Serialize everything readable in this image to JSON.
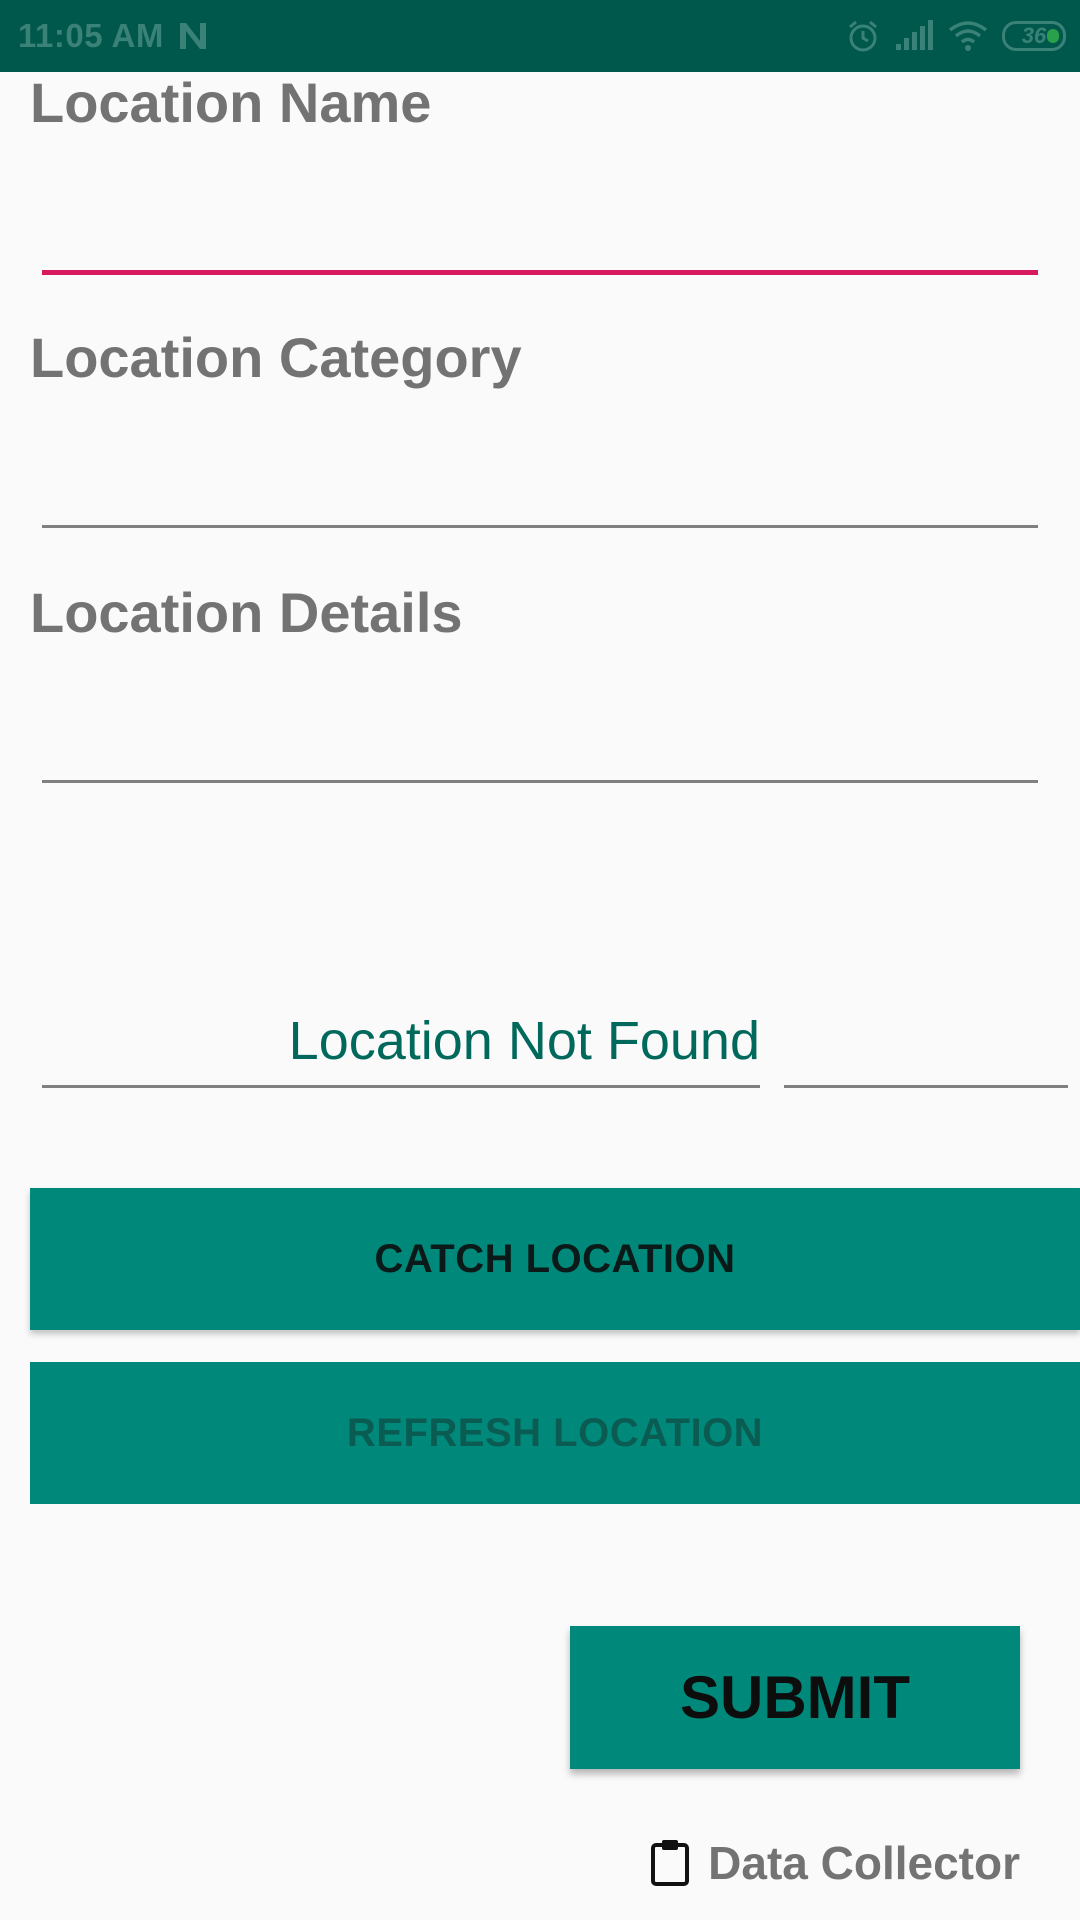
{
  "status_bar": {
    "time": "11:05 AM",
    "battery_level": "36",
    "icons": [
      "n-notification-icon",
      "alarm-icon",
      "signal-icon",
      "wifi-icon",
      "battery-icon"
    ]
  },
  "form": {
    "location_name": {
      "label": "Location Name",
      "value": "",
      "focused": true
    },
    "location_category": {
      "label": "Location Category",
      "value": ""
    },
    "location_details": {
      "label": "Location Details",
      "value": ""
    }
  },
  "location_status": "Location Not Found",
  "buttons": {
    "catch_location": "CATCH LOCATION",
    "refresh_location": "REFRESH LOCATION",
    "submit": "SUBMIT"
  },
  "footer": {
    "icon": "clipboard-icon",
    "label": "Data Collector"
  },
  "colors": {
    "status_bar": "#00574b",
    "accent": "#00897b",
    "focus_underline": "#d81b60",
    "status_text": "#00695c"
  }
}
